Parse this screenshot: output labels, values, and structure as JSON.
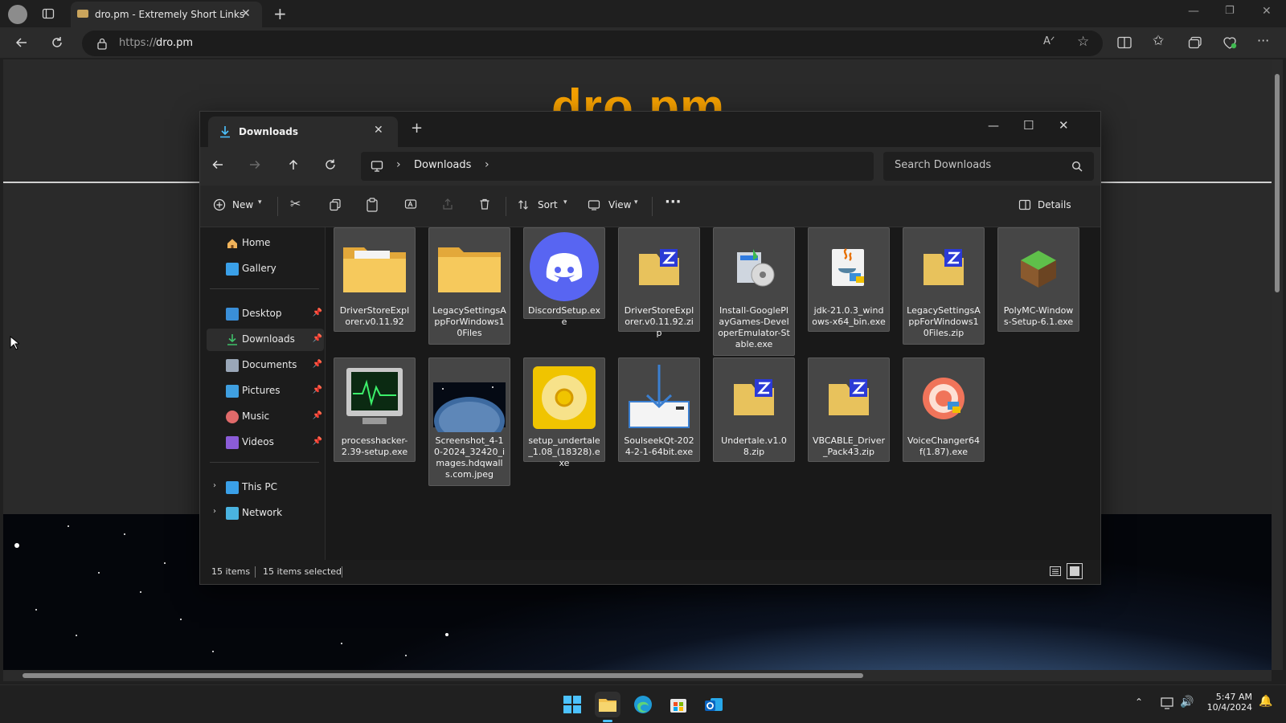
{
  "browser": {
    "tab_title": "dro.pm - Extremely Short Links",
    "url_prefix": "https://",
    "url_host": "dro.pm"
  },
  "page": {
    "logo_text": "dro.pm"
  },
  "explorer": {
    "tab_title": "Downloads",
    "breadcrumb": [
      "Downloads"
    ],
    "search_placeholder": "Search Downloads",
    "commands": {
      "new": "New",
      "sort": "Sort",
      "view": "View",
      "more": "···",
      "details": "Details"
    },
    "sidebar": {
      "top": [
        {
          "label": "Home",
          "icon": "home-icon"
        },
        {
          "label": "Gallery",
          "icon": "gallery-icon"
        }
      ],
      "pinned": [
        {
          "label": "Desktop",
          "icon": "desktop-icon"
        },
        {
          "label": "Downloads",
          "icon": "downloads-icon",
          "selected": true
        },
        {
          "label": "Documents",
          "icon": "documents-icon"
        },
        {
          "label": "Pictures",
          "icon": "pictures-icon"
        },
        {
          "label": "Music",
          "icon": "music-icon"
        },
        {
          "label": "Videos",
          "icon": "videos-icon"
        }
      ],
      "bottom": [
        {
          "label": "This PC",
          "icon": "this-pc-icon"
        },
        {
          "label": "Network",
          "icon": "network-icon"
        }
      ]
    },
    "files": [
      {
        "name": "DriverStoreExplorer.v0.11.92",
        "icon": "folder-icon"
      },
      {
        "name": "LegacySettingsAppForWindows10Files",
        "icon": "folder-icon"
      },
      {
        "name": "DiscordSetup.exe",
        "icon": "discord-icon"
      },
      {
        "name": "DriverStoreExplorer.v0.11.92.zip",
        "icon": "zip-icon"
      },
      {
        "name": "Install-GooglePlayGames-DeveloperEmulator-Stable.exe",
        "icon": "installer-icon"
      },
      {
        "name": "jdk-21.0.3_windows-x64_bin.exe",
        "icon": "java-icon"
      },
      {
        "name": "LegacySettingsAppForWindows10Files.zip",
        "icon": "zip-icon"
      },
      {
        "name": "PolyMC-Windows-Setup-6.1.exe",
        "icon": "polymc-icon"
      },
      {
        "name": "processhacker-2.39-setup.exe",
        "icon": "monitor-icon"
      },
      {
        "name": "Screenshot_4-10-2024_32420_images.hdqwalls.com.jpeg",
        "icon": "image-thumbnail"
      },
      {
        "name": "setup_undertale_1.08_(18328).exe",
        "icon": "gog-setup-icon"
      },
      {
        "name": "SoulseekQt-2024-2-1-64bit.exe",
        "icon": "soulseek-icon"
      },
      {
        "name": "Undertale.v1.08.zip",
        "icon": "zip-icon"
      },
      {
        "name": "VBCABLE_Driver_Pack43.zip",
        "icon": "zip-icon"
      },
      {
        "name": "VoiceChanger64f(1.87).exe",
        "icon": "voicechanger-icon"
      }
    ],
    "status": {
      "items": "15 items",
      "selected": "15 items selected"
    }
  },
  "taskbar": {
    "time": "5:47 AM",
    "date": "10/4/2024"
  },
  "colors": {
    "logo": "#f5a000",
    "folder": "#f2c14e",
    "discord": "#5865f2",
    "accent": "#4cc2ff"
  }
}
